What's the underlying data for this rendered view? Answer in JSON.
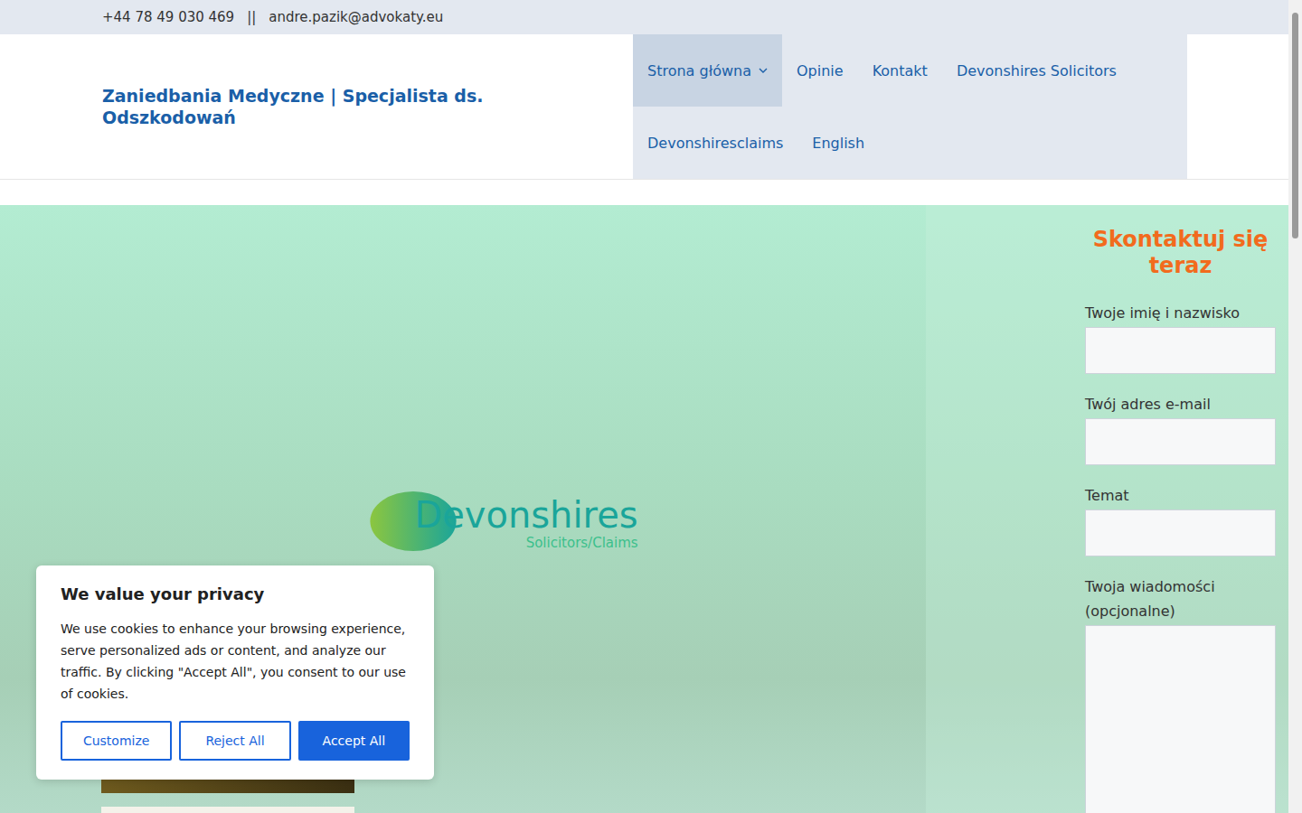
{
  "topbar": {
    "phone": "+44 78 49 030 469",
    "separator": "||",
    "email": "andre.pazik@advokaty.eu"
  },
  "site_title": "Zaniedbania Medyczne | Specjalista ds. Odszkodowań",
  "nav": [
    {
      "label": "Strona główna",
      "selected": true,
      "has_dropdown": true
    },
    {
      "label": "Opinie",
      "selected": false,
      "has_dropdown": false
    },
    {
      "label": "Kontakt",
      "selected": false,
      "has_dropdown": false
    },
    {
      "label": "Devonshires Solicitors",
      "selected": false,
      "has_dropdown": false
    },
    {
      "label": "Devonshiresclaims",
      "selected": false,
      "has_dropdown": false
    },
    {
      "label": "English",
      "selected": false,
      "has_dropdown": false
    }
  ],
  "hero": {
    "logo": {
      "name": "Devonshires",
      "tagline": "Solicitors/Claims"
    }
  },
  "contact_form": {
    "title": "Skontaktuj się teraz",
    "fields": [
      {
        "label": "Twoje imię i nazwisko",
        "kind": "input"
      },
      {
        "label": "Twój adres e-mail",
        "kind": "input"
      },
      {
        "label": "Temat",
        "kind": "input"
      },
      {
        "label": "Twoja wiadomości (opcjonalne)",
        "kind": "textarea"
      }
    ]
  },
  "cookie_banner": {
    "title": "We value your privacy",
    "text": "We use cookies to enhance your browsing experience, serve personalized ads or content, and analyze our traffic. By clicking \"Accept All\", you consent to our use of cookies.",
    "buttons": [
      {
        "label": "Customize",
        "kind": "outline"
      },
      {
        "label": "Reject All",
        "kind": "outline"
      },
      {
        "label": "Accept All",
        "kind": "primary"
      }
    ]
  }
}
